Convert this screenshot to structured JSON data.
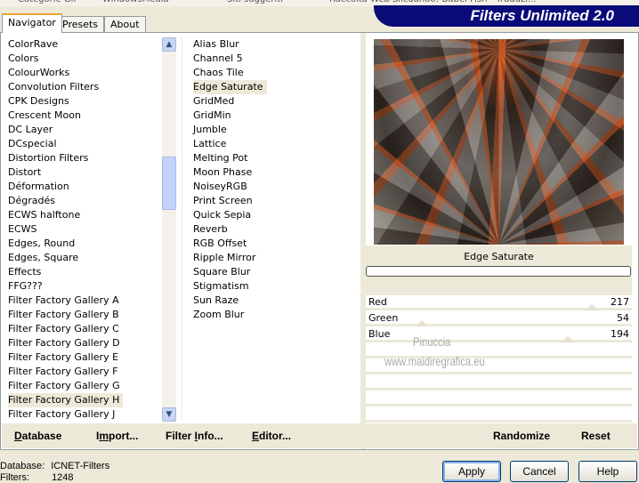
{
  "browser_bar": [
    "Categorie Gif",
    "WindowsMedia",
    "Siti suggeriti",
    "Raccolta Web Slice",
    "Yahoo! Babel Fish - Traduzi..."
  ],
  "app_title": "Filters Unlimited 2.0",
  "tabs": [
    {
      "label": "Navigator",
      "active": true
    },
    {
      "label": "Presets"
    },
    {
      "label": "About"
    }
  ],
  "categories": [
    "ColorRave",
    "Colors",
    "ColourWorks",
    "Convolution Filters",
    "CPK Designs",
    "Crescent Moon",
    "DC Layer",
    "DCspecial",
    "Distortion Filters",
    "Distort",
    "Déformation",
    "Dégradés",
    "ECWS halftone",
    "ECWS",
    "Edges, Round",
    "Edges, Square",
    "Effects",
    "FFG???",
    "Filter Factory Gallery A",
    "Filter Factory Gallery B",
    "Filter Factory Gallery C",
    "Filter Factory Gallery D",
    "Filter Factory Gallery E",
    "Filter Factory Gallery F",
    "Filter Factory Gallery G",
    "Filter Factory Gallery H",
    "Filter Factory Gallery J"
  ],
  "selected_category": "Filter Factory Gallery H",
  "filters": [
    "Alias Blur",
    "Channel 5",
    "Chaos Tile",
    "Edge Saturate",
    "GridMed",
    "GridMin",
    "Jumble",
    "Lattice",
    "Melting Pot",
    "Moon Phase",
    "NoiseyRGB",
    "Print Screen",
    "Quick Sepia",
    "Reverb",
    "RGB Offset",
    "Ripple Mirror",
    "Square Blur",
    "Stigmatism",
    "Sun Raze",
    "Zoom Blur"
  ],
  "selected_filter": "Edge Saturate",
  "filter_name": "Edge Saturate",
  "progress": 0,
  "sliders": [
    {
      "label": "Red",
      "value": "217",
      "max": 255
    },
    {
      "label": "Green",
      "value": "54",
      "max": 255
    },
    {
      "label": "Blue",
      "value": "194",
      "max": 255
    }
  ],
  "watermark": {
    "line1": "Pinuccia",
    "line2": "www.maidiregrafica.eu"
  },
  "left_buttons": [
    {
      "label": "Database",
      "u": "D"
    },
    {
      "label": "Import...",
      "u": "m"
    },
    {
      "label": "Filter Info...",
      "u": "I"
    },
    {
      "label": "Editor...",
      "u": "E"
    }
  ],
  "randomize": "Randomize",
  "reset": "Reset",
  "status": {
    "database_label": "Database:",
    "database_value": "ICNET-Filters",
    "filters_label": "Filters:",
    "filters_value": "1248"
  },
  "apply": "Apply",
  "cancel": "Cancel",
  "help": "Help"
}
